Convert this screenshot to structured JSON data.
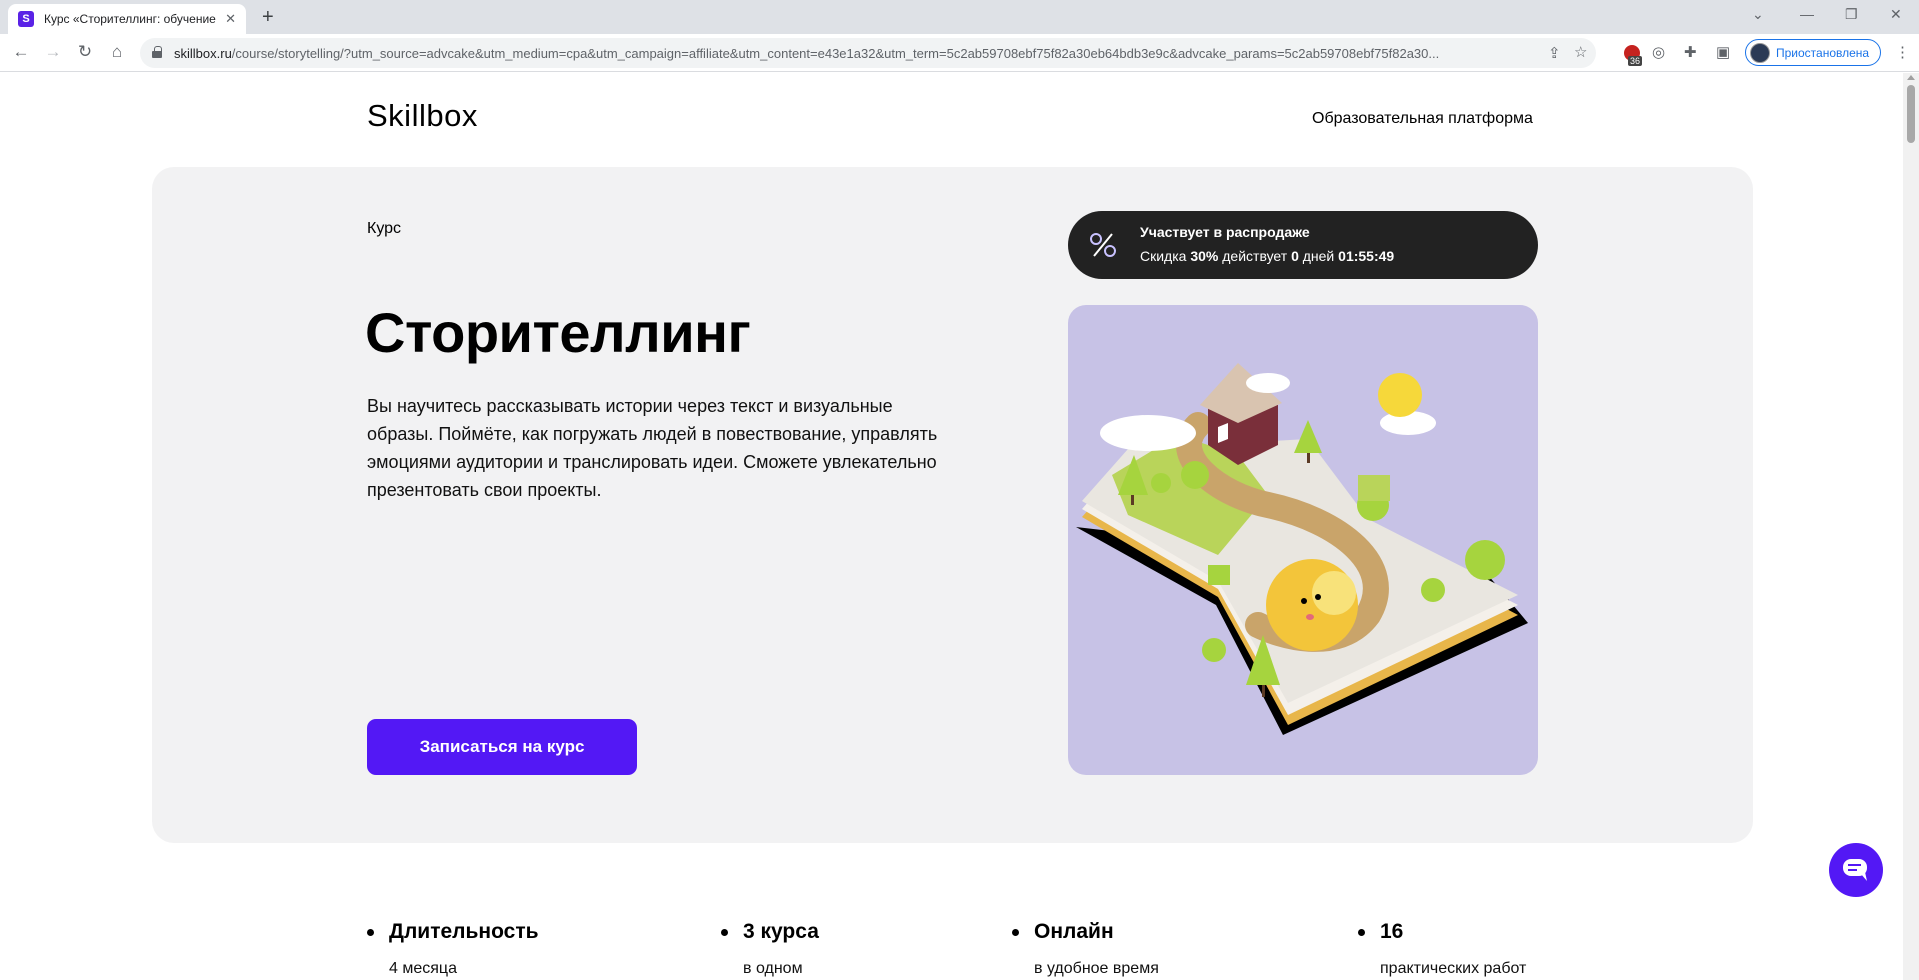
{
  "browser": {
    "tab_title": "Курс «Сторителлинг: обучение",
    "tab_favicon": "S",
    "tab_close": "✕",
    "new_tab": "+",
    "url_host": "skillbox.ru",
    "url_rest": "/course/storytelling/?utm_source=advcake&utm_medium=cpa&utm_campaign=affiliate&utm_content=e43e1a32&utm_term=5c2ab59708ebf75f82a30eb64bdb3e9c&advcake_params=5c2ab59708ebf75f82a30...",
    "profile_label": "Приостановлена",
    "extension_count": "36"
  },
  "header": {
    "logo": "Skillbox",
    "platform_link": "Образовательная платформа"
  },
  "hero": {
    "label": "Курс",
    "title": "Сторителлинг",
    "description": "Вы научитесь рассказывать истории через текст и визуальные образы. Поймёте, как погружать людей в повествование, управлять эмоциями аудитории и транслировать идеи. Сможете увлекательно презентовать свои проекты.",
    "cta_label": "Записаться на курс",
    "sale": {
      "title": "Участвует в распродаже",
      "prefix": "Скидка ",
      "discount": "30%",
      "middle": " действует ",
      "days": "0",
      "days_word": " дней ",
      "timer": "01:55:49"
    }
  },
  "facts": [
    {
      "title": "Длительность",
      "sub": "4 месяца"
    },
    {
      "title": "3 курса",
      "sub": "в одном"
    },
    {
      "title": "Онлайн",
      "sub": "в удобное время"
    },
    {
      "title": "16",
      "sub": "практических работ"
    }
  ],
  "colors": {
    "brand": "#5318f5",
    "hero_bg": "#f2f2f3",
    "pill_bg": "#222222",
    "illustration_bg": "#c7c2e6"
  }
}
